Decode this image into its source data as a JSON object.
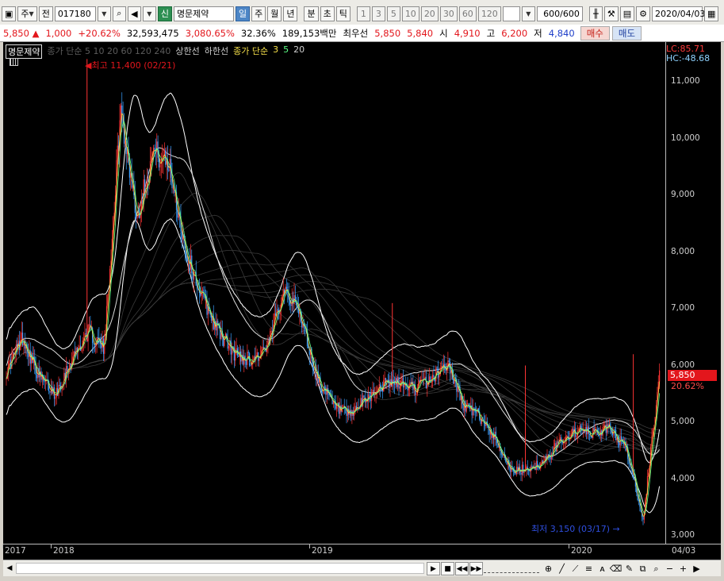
{
  "toolbar": {
    "market_label": "주",
    "prev_label": "전",
    "code_value": "017180",
    "tag_new": "신",
    "stock_name": "명문제약",
    "periods": [
      "일",
      "주",
      "월",
      "년"
    ],
    "intraday": [
      "분",
      "초",
      "틱"
    ],
    "minutes": [
      "1",
      "3",
      "5",
      "10",
      "20",
      "30",
      "60",
      "120"
    ],
    "count_value": "600",
    "count_total": "/600",
    "date_value": "2020/04/03"
  },
  "quote": {
    "price": "5,850",
    "up_arrow": "▲",
    "change": "1,000",
    "change_pct": "+20.62%",
    "volume": "32,593,475",
    "volume_pct": "3,080.65%",
    "turnover": "32.36%",
    "amount": "189,153백만",
    "best_label": "최우선",
    "ask": "5,850",
    "bid": "5,840",
    "open_label": "시",
    "open": "4,910",
    "high_label": "고",
    "high": "6,200",
    "low_label": "저",
    "low": "4,840",
    "buy_label": "매수",
    "sell_label": "매도"
  },
  "chart": {
    "legend_name": "명문제약",
    "legend_dim": "종가 단순 5 10 20 60 120 240",
    "legend_upper": "상한선",
    "legend_lower": "하한선",
    "legend_ma_label": "종가 단순",
    "legend_ma": [
      "3",
      "5",
      "20"
    ],
    "lc": "LC:85.71",
    "hc": "HC:-48.68",
    "high_note": "최고 11,400 (02/21)",
    "low_note": "최저 3,150 (03/17)",
    "last_price": "5,850",
    "last_pct": "20.62%",
    "y_ticks": [
      "11,000",
      "10,000",
      "9,000",
      "8,000",
      "7,000",
      "6,000",
      "5,000",
      "4,000",
      "3,000"
    ],
    "x_ticks": [
      "2017",
      "2018",
      "2019",
      "2020",
      "04/03"
    ],
    "colors": {
      "up": "#ff3434",
      "down": "#3aa0ff",
      "ma3": "#ffe04a",
      "ma5": "#5cff86",
      "band": "#ffffff",
      "bg": "#000000"
    }
  },
  "chart_data": {
    "type": "line",
    "ylim": [
      3000,
      11400
    ],
    "series": [
      {
        "values": [
          5900,
          6500,
          5800,
          5500,
          6100,
          6600,
          6300,
          10500,
          8600,
          9800,
          9500,
          8000,
          7200,
          6600,
          6200,
          6100,
          6300,
          7400,
          6900,
          5800,
          5300,
          5100,
          5400,
          5650,
          5700,
          5600,
          5750,
          6050,
          5300,
          5100,
          4700,
          4100,
          4200,
          4300,
          4700,
          4850,
          4800,
          4900,
          4500,
          3300,
          5850
        ]
      }
    ]
  }
}
